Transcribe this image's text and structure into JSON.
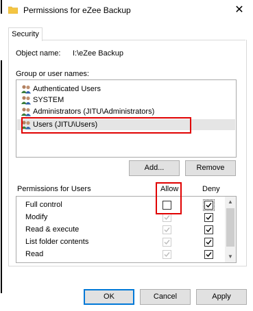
{
  "window": {
    "title": "Permissions for eZee Backup",
    "close_glyph": "✕"
  },
  "tabs": [
    {
      "label": "Security"
    }
  ],
  "object_name": {
    "label": "Object name:",
    "value": "I:\\eZee Backup"
  },
  "group_section": {
    "label": "Group or user names:"
  },
  "users": [
    {
      "label": "Authenticated Users"
    },
    {
      "label": "SYSTEM"
    },
    {
      "label": "Administrators (JITU\\Administrators)"
    },
    {
      "label": "Users (JITU\\Users)",
      "selected": true
    }
  ],
  "buttons": {
    "add": "Add...",
    "remove": "Remove",
    "ok": "OK",
    "cancel": "Cancel",
    "apply": "Apply"
  },
  "permissions": {
    "header_label": "Permissions for Users",
    "allow_label": "Allow",
    "deny_label": "Deny",
    "rows": [
      {
        "label": "Full control",
        "allow": false,
        "allow_disabled": false,
        "deny": true
      },
      {
        "label": "Modify",
        "allow": true,
        "allow_disabled": true,
        "deny": true
      },
      {
        "label": "Read & execute",
        "allow": true,
        "allow_disabled": true,
        "deny": true
      },
      {
        "label": "List folder contents",
        "allow": true,
        "allow_disabled": true,
        "deny": true
      },
      {
        "label": "Read",
        "allow": true,
        "allow_disabled": true,
        "deny": true
      }
    ]
  },
  "colors": {
    "highlight": "#e00000",
    "selection": "#e5e5e5",
    "accent": "#0078d7"
  },
  "icons": {
    "folder": "folder-icon",
    "user_group": "users-icon"
  }
}
